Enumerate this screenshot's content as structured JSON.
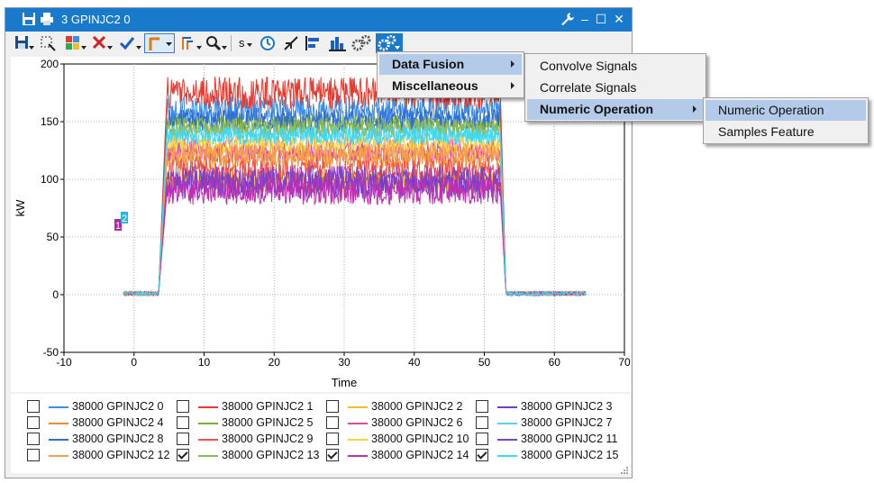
{
  "window": {
    "title": "3 GPINJC2 0",
    "title_color": "#1979ca"
  },
  "toolbar": {
    "buttons": [
      "save-icon",
      "zoom-region-icon",
      "color-palette-icon",
      "delete-icon",
      "check-icon",
      "cursor-icon",
      "multi-cursor-icon",
      "zoom-icon",
      "units-icon",
      "clock-icon",
      "collapse-icon",
      "align-left-icon",
      "bar-chart-icon",
      "gears-icon",
      "gear-menu-icon"
    ],
    "units_label": "s"
  },
  "menus": {
    "level1": [
      {
        "label": "Data Fusion",
        "highlighted": true
      },
      {
        "label": "Miscellaneous",
        "highlighted": false
      }
    ],
    "level2": [
      {
        "label": "Convolve Signals",
        "highlighted": false
      },
      {
        "label": "Correlate Signals",
        "highlighted": false
      },
      {
        "label": "Numeric Operation",
        "highlighted": true
      }
    ],
    "level3": [
      {
        "label": "Numeric Operation",
        "highlighted": true
      },
      {
        "label": "Samples Feature",
        "highlighted": false
      }
    ]
  },
  "chart_data": {
    "type": "line",
    "xlabel": "Time",
    "ylabel": "kW",
    "xlim": [
      -10,
      70
    ],
    "ylim": [
      -50,
      200
    ],
    "xticks": [
      -10,
      0,
      10,
      20,
      30,
      40,
      50,
      60,
      70
    ],
    "yticks": [
      -50,
      0,
      50,
      100,
      150,
      200
    ],
    "grid": true,
    "cursor_markers": [
      "1",
      "2"
    ],
    "marker_colors": [
      "#b02aa4",
      "#2ab7d8"
    ],
    "series": [
      {
        "name": "38000 GPINJC2 0",
        "color": "#3a8ee6",
        "checked": false,
        "start": -1.5,
        "rise": 3.5,
        "fall": 52.3,
        "end": 64.5,
        "baseline": 1,
        "level": 160,
        "noise": 12
      },
      {
        "name": "38000 GPINJC2 1",
        "color": "#e8392f",
        "checked": false,
        "start": -1.5,
        "rise": 3.5,
        "fall": 52.3,
        "end": 64.5,
        "baseline": 1,
        "level": 175,
        "noise": 14
      },
      {
        "name": "38000 GPINJC2 2",
        "color": "#f0c020",
        "checked": false,
        "start": -1.5,
        "rise": 3.5,
        "fall": 52.3,
        "end": 64.5,
        "baseline": 1,
        "level": 98,
        "noise": 10
      },
      {
        "name": "38000 GPINJC2 3",
        "color": "#6a3fd0",
        "checked": false,
        "start": -1.5,
        "rise": 3.5,
        "fall": 52.3,
        "end": 64.5,
        "baseline": 1,
        "level": 95,
        "noise": 12
      },
      {
        "name": "38000 GPINJC2 4",
        "color": "#f28a30",
        "checked": false,
        "start": -1.5,
        "rise": 3.5,
        "fall": 52.3,
        "end": 64.5,
        "baseline": 1,
        "level": 118,
        "noise": 10
      },
      {
        "name": "38000 GPINJC2 5",
        "color": "#7ab03a",
        "checked": false,
        "start": -1.5,
        "rise": 3.5,
        "fall": 52.3,
        "end": 64.5,
        "baseline": 1,
        "level": 148,
        "noise": 8
      },
      {
        "name": "38000 GPINJC2 6",
        "color": "#e04aa0",
        "checked": false,
        "start": -1.5,
        "rise": 3.5,
        "fall": 52.3,
        "end": 64.5,
        "baseline": 1,
        "level": 125,
        "noise": 10
      },
      {
        "name": "38000 GPINJC2 7",
        "color": "#5fd0f0",
        "checked": false,
        "start": -1.5,
        "rise": 3.5,
        "fall": 52.3,
        "end": 64.5,
        "baseline": 1,
        "level": 140,
        "noise": 8
      },
      {
        "name": "38000 GPINJC2 8",
        "color": "#2f6fd0",
        "checked": false,
        "start": -1.5,
        "rise": 3.5,
        "fall": 52.3,
        "end": 64.5,
        "baseline": 1,
        "level": 152,
        "noise": 10
      },
      {
        "name": "38000 GPINJC2 9",
        "color": "#f05050",
        "checked": false,
        "start": -1.5,
        "rise": 3.5,
        "fall": 52.3,
        "end": 64.5,
        "baseline": 1,
        "level": 108,
        "noise": 10
      },
      {
        "name": "38000 GPINJC2 10",
        "color": "#f7d240",
        "checked": false,
        "start": -1.5,
        "rise": 3.5,
        "fall": 52.3,
        "end": 64.5,
        "baseline": 1,
        "level": 130,
        "noise": 8
      },
      {
        "name": "38000 GPINJC2 11",
        "color": "#8040c8",
        "checked": false,
        "start": -1.5,
        "rise": 3.5,
        "fall": 52.3,
        "end": 64.5,
        "baseline": 1,
        "level": 100,
        "noise": 12
      },
      {
        "name": "38000 GPINJC2 12",
        "color": "#f5a050",
        "checked": false,
        "start": -1.5,
        "rise": 3.5,
        "fall": 52.3,
        "end": 64.5,
        "baseline": 1,
        "level": 122,
        "noise": 8
      },
      {
        "name": "38000 GPINJC2 13",
        "color": "#8fba50",
        "checked": true,
        "start": -1.5,
        "rise": 3.5,
        "fall": 52.3,
        "end": 64.5,
        "baseline": 1,
        "level": 145,
        "noise": 8
      },
      {
        "name": "38000 GPINJC2 14",
        "color": "#c030b0",
        "checked": true,
        "start": -1.5,
        "rise": 3.5,
        "fall": 52.3,
        "end": 64.5,
        "baseline": 1,
        "level": 90,
        "noise": 12
      },
      {
        "name": "38000 GPINJC2 15",
        "color": "#40d8f0",
        "checked": true,
        "start": -1.5,
        "rise": 3.5,
        "fall": 52.3,
        "end": 64.5,
        "baseline": 1,
        "level": 138,
        "noise": 8
      }
    ]
  }
}
